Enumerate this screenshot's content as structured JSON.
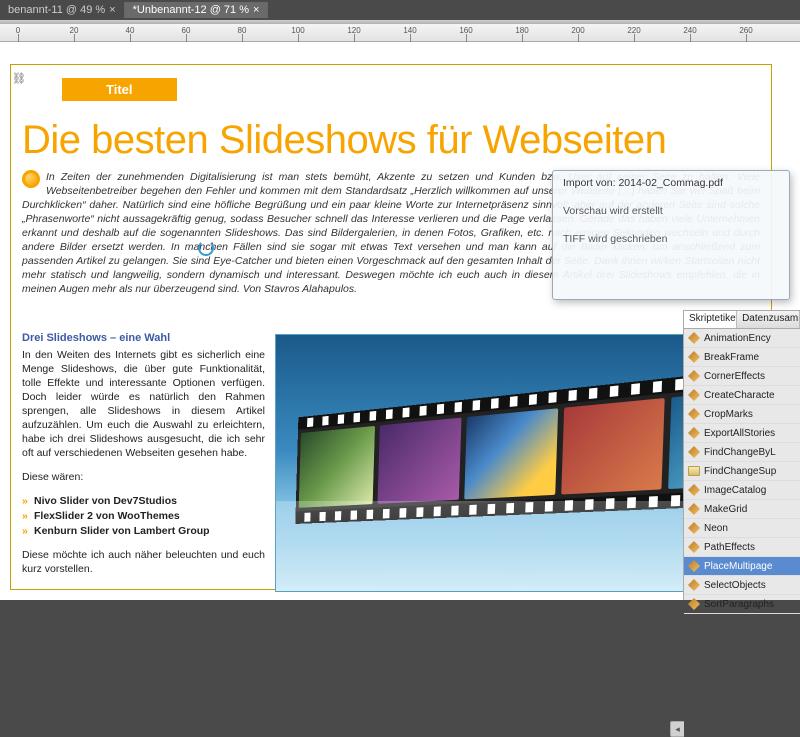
{
  "tabs": [
    {
      "label": "benannt-11 @ 49 %",
      "active": false
    },
    {
      "label": "*Unbenannt-12 @ 71 %",
      "active": true
    }
  ],
  "ruler": [
    "0",
    "20",
    "40",
    "60",
    "80",
    "100",
    "120",
    "140",
    "160",
    "180",
    "200",
    "220",
    "240",
    "260"
  ],
  "page": {
    "badge": "Titel",
    "headline": "Die besten Slideshows für Webseiten",
    "intro": "In Zeiten der zunehmenden Digitalisierung ist man stets bemüht, Akzente zu setzen und Kunden bzw. User auf seiner Seite zu halten. Viele Webseitenbetreiber begehen den Fehler und kommen mit dem Standardsatz „Herzlich willkommen auf unserer Webseite […] haben Sie viel Spaß beim Durchklicken“ daher. Natürlich sind eine höfliche Begrüßung und ein paar kleine Worte zur Internetpräsenz sinnvoll, aber auf der anderen Seite sind solche „Phrasenworte“ nicht aussagekräftig genug, sodass Besucher schnell das Interesse verlieren und die Page verlassen. Gerade das haben viele Unternehmen erkannt und deshalb auf die sogenannten Slideshows. Das sind Bildergalerien, in denen Fotos, Grafiken, etc. nach einigen Sekunden wechseln und durch andere Bilder ersetzt werden. In manchen Fällen sind sie sogar mit etwas Text versehen und man kann auf die Bilder klicken, um anschließend zum passenden Artikel zu gelangen. Sie sind Eye-Catcher und bieten einen Vorgeschmack auf den gesamten Inhalt der Seite. Dank ihnen wirken Startseiten nicht mehr statisch und langweilig, sondern dynamisch und interessant. Deswegen möchte ich euch auch in diesem Artikel drei Slideshows empfehlen, die in meinen Augen mehr als nur überzeugend sind. Von Stavros Alahapulos.",
    "subhead": "Drei Slideshows – eine Wahl",
    "col_p1": "In den Weiten des Internets gibt es sicherlich eine Menge Slideshows, die über gute Funktionalität, tolle Effekte und interessante Optionen verfügen. Doch leider würde es natürlich den Rahmen sprengen, alle Slideshows in diesem Artikel aufzuzählen. Um euch die Auswahl zu erleichtern, habe ich drei Slideshows ausgesucht, die ich sehr oft auf verschiedenen Webseiten gesehen habe.",
    "col_p2": "Diese wären:",
    "bullets": [
      "Nivo Slider von Dev7Studios",
      "FlexSlider 2 von WooThemes",
      "Kenburn Slider von Lambert Group"
    ],
    "col_p3": "Diese möchte ich auch näher beleuchten und euch kurz vorstellen."
  },
  "import_popup": {
    "title": "Import von: 2014-02_Commag.pdf",
    "line1": "Vorschau wird erstellt",
    "line2": "TIFF wird geschrieben"
  },
  "panel": {
    "tabs": [
      "Skriptetikett",
      "Datenzusamm"
    ],
    "items": [
      {
        "label": "AnimationEncy",
        "type": "script"
      },
      {
        "label": "BreakFrame",
        "type": "script"
      },
      {
        "label": "CornerEffects",
        "type": "script"
      },
      {
        "label": "CreateCharacte",
        "type": "script"
      },
      {
        "label": "CropMarks",
        "type": "script"
      },
      {
        "label": "ExportAllStories",
        "type": "script"
      },
      {
        "label": "FindChangeByL",
        "type": "script"
      },
      {
        "label": "FindChangeSup",
        "type": "folder"
      },
      {
        "label": "ImageCatalog",
        "type": "script"
      },
      {
        "label": "MakeGrid",
        "type": "script"
      },
      {
        "label": "Neon",
        "type": "script"
      },
      {
        "label": "PathEffects",
        "type": "script"
      },
      {
        "label": "PlaceMultipage",
        "type": "script",
        "selected": true
      },
      {
        "label": "SelectObjects",
        "type": "script"
      },
      {
        "label": "SortParagraphs",
        "type": "script"
      }
    ]
  }
}
